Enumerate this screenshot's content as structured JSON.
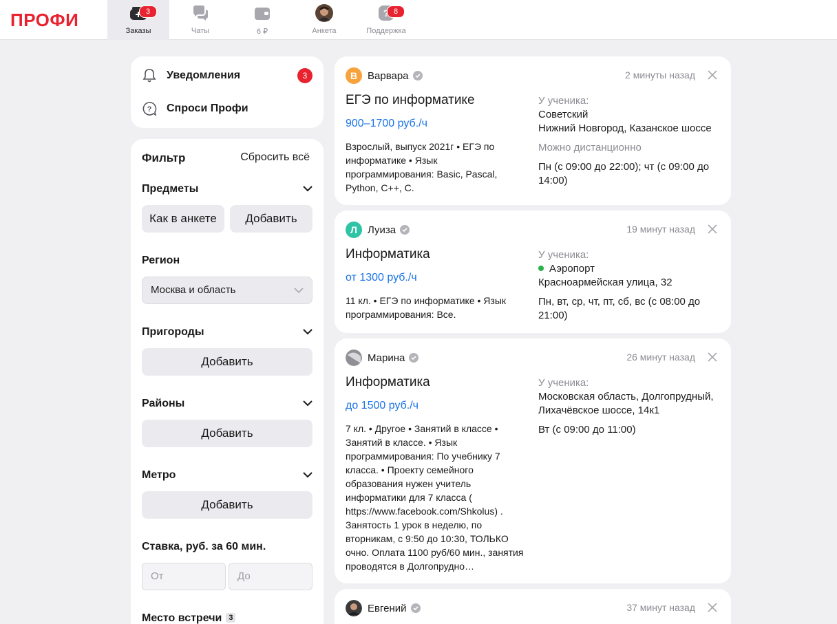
{
  "brand": {
    "logo": "ПРОФИ"
  },
  "nav": [
    {
      "label": "Заказы",
      "icon": "orders-icon",
      "badge": "3",
      "active": true
    },
    {
      "label": "Чаты",
      "icon": "chat-icon"
    },
    {
      "label": "6 ₽",
      "icon": "wallet-icon"
    },
    {
      "label": "Анкета",
      "icon": "profile-avatar"
    },
    {
      "label": "Поддержка",
      "icon": "help-icon",
      "badge": "8"
    }
  ],
  "side": {
    "notifications_label": "Уведомления",
    "notifications_count": "3",
    "ask_label": "Спроси Профи"
  },
  "filter": {
    "title": "Фильтр",
    "reset": "Сбросить всё",
    "subjects_title": "Предметы",
    "subjects_profile_btn": "Как в анкете",
    "subjects_add_btn": "Добавить",
    "region_title": "Регион",
    "region_value": "Москва и область",
    "suburbs_title": "Пригороды",
    "suburbs_add": "Добавить",
    "districts_title": "Районы",
    "districts_add": "Добавить",
    "metro_title": "Метро",
    "metro_add": "Добавить",
    "rate_title": "Ставка, руб. за 60 мин.",
    "rate_from_placeholder": "От",
    "rate_to_placeholder": "До",
    "meeting_title": "Место встречи",
    "meeting_count": "3"
  },
  "orders": [
    {
      "name": "Варвара",
      "avatar_letter": "В",
      "avatar_color": "#f7a23b",
      "time": "2 минуты назад",
      "subject": "ЕГЭ по информатике",
      "price": "900–1700 руб./ч",
      "description": "Взрослый, выпуск 2021г • ЕГЭ по информатике • Язык программирования: Basic, Pascal, Python, C++, C.",
      "location_label": "У ученика:",
      "location_line1": "Советский",
      "location_line2": "Нижний Новгород, Казанское шоссе",
      "remote": "Можно дистанционно",
      "schedule": "Пн (с 09:00 до 22:00); чт (с 09:00 до 14:00)"
    },
    {
      "name": "Луиза",
      "avatar_letter": "Л",
      "avatar_color": "#2ec4a5",
      "time": "19 минут назад",
      "subject": "Информатика",
      "price": "от 1300 руб./ч",
      "description": "11 кл. • ЕГЭ по информатике • Язык программирования: Все.",
      "location_label": "У ученика:",
      "metro": "Аэропорт",
      "location_line2": "Красноармейская улица, 32",
      "schedule": "Пн, вт, ср, чт, пт, сб, вс (с 08:00 до 21:00)"
    },
    {
      "name": "Марина",
      "avatar_letter": "",
      "avatar_color": "#9a9aa0",
      "time": "26 минут назад",
      "subject": "Информатика",
      "price": "до 1500 руб./ч",
      "description": "7 кл. • Другое • Занятий в классе • Занятий в классе. • Язык программирования: По учебнику 7 класса. • Проекту семейного образования нужен учитель информатики для 7 класса ( https://www.facebook.com/Shkolus) . Занятость 1 урок в неделю, по вторникам, с 9:50 до 10:30, ТОЛЬКО очно. Оплата 1100 руб/60 мин., занятия проводятся в Долгопрудно…",
      "location_label": "У ученика:",
      "location_line1": "Московская область, Долгопрудный, Лихачёвское шоссе, 14к1",
      "schedule": "Вт (с 09:00 до 11:00)"
    },
    {
      "name": "Евгений",
      "avatar_letter": "",
      "avatar_color": "#3a3a3a",
      "time": "37 минут назад"
    }
  ]
}
